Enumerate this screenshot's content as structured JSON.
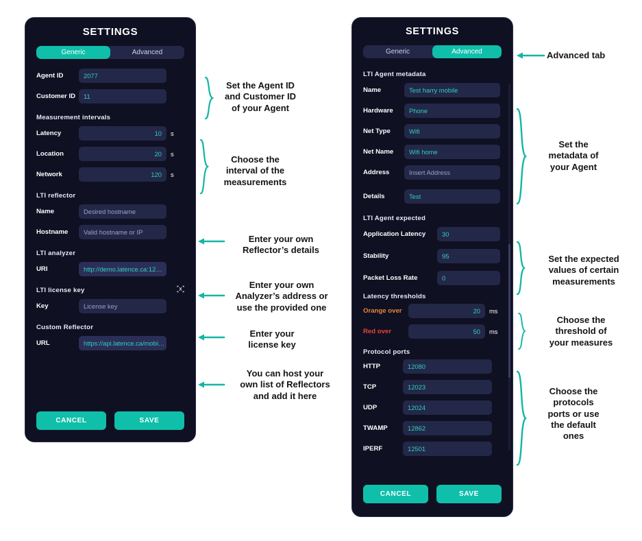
{
  "theme": {
    "page_bg": "#ffffff",
    "panel_bg": "#0f1022",
    "input_bg": "#232748",
    "accent_teal": "#0fbfaa",
    "value_teal": "#2fd0bb",
    "placeholder": "#9ca2c4",
    "orange": "#e8873a",
    "red": "#e8453c",
    "annotation_text": "#141414"
  },
  "generic_panel": {
    "title": "SETTINGS",
    "tabs": [
      {
        "label": "Generic",
        "active": true
      },
      {
        "label": "Advanced",
        "active": false
      }
    ],
    "identity": {
      "rows": [
        {
          "label": "Agent ID",
          "value": "2077",
          "placeholder": "",
          "align": "left"
        },
        {
          "label": "Customer ID",
          "value": "11",
          "placeholder": "",
          "align": "left"
        }
      ]
    },
    "measurement_intervals": {
      "heading": "Measurement intervals",
      "rows": [
        {
          "label": "Latency",
          "value": "10",
          "unit": "s",
          "align": "right"
        },
        {
          "label": "Location",
          "value": "20",
          "unit": "s",
          "align": "right"
        },
        {
          "label": "Network",
          "value": "120",
          "unit": "s",
          "align": "right"
        }
      ]
    },
    "lti_reflector": {
      "heading": "LTI reflector",
      "rows": [
        {
          "label": "Name",
          "value": "",
          "placeholder": "Desired hostname"
        },
        {
          "label": "Hostname",
          "value": "",
          "placeholder": "Valid hostname or IP"
        }
      ]
    },
    "lti_analyzer": {
      "heading": "LTI analyzer",
      "rows": [
        {
          "label": "URI",
          "value": "http://demo.latence.ca:12…",
          "placeholder": ""
        }
      ]
    },
    "lti_license_key": {
      "heading": "LTI license key",
      "icon": "scan-qr-icon",
      "rows": [
        {
          "label": "Key",
          "value": "",
          "placeholder": "License key"
        }
      ]
    },
    "custom_reflector": {
      "heading": "Custom Reflector",
      "rows": [
        {
          "label": "URL",
          "value": "https://api.latence.ca/mobi…",
          "placeholder": ""
        }
      ]
    },
    "buttons": {
      "cancel": "CANCEL",
      "save": "SAVE"
    }
  },
  "advanced_panel": {
    "title": "SETTINGS",
    "tabs": [
      {
        "label": "Generic",
        "active": false
      },
      {
        "label": "Advanced",
        "active": true
      }
    ],
    "agent_metadata": {
      "heading": "LTI Agent metadata",
      "rows": [
        {
          "label": "Name",
          "value": "Test harry mobile",
          "placeholder": ""
        },
        {
          "label": "Hardware",
          "value": "Phone",
          "placeholder": ""
        },
        {
          "label": "Net Type",
          "value": "Wifi",
          "placeholder": ""
        },
        {
          "label": "Net Name",
          "value": "Wifi home",
          "placeholder": ""
        },
        {
          "label": "Address",
          "value": "",
          "placeholder": "Insert Address"
        },
        {
          "label": "Details",
          "value": "Test",
          "placeholder": ""
        }
      ]
    },
    "agent_expected": {
      "heading": "LTI Agent expected",
      "rows": [
        {
          "label": "Application Latency",
          "value": "30"
        },
        {
          "label": "Stability",
          "value": "95"
        },
        {
          "label": "Packet Loss Rate",
          "value": "0"
        }
      ]
    },
    "latency_thresholds": {
      "heading": "Latency thresholds",
      "rows": [
        {
          "label": "Orange over",
          "value": "20",
          "unit": "ms",
          "color": "orange"
        },
        {
          "label": "Red over",
          "value": "50",
          "unit": "ms",
          "color": "red"
        }
      ]
    },
    "protocol_ports": {
      "heading": "Protocol ports",
      "rows": [
        {
          "label": "HTTP",
          "value": "12080"
        },
        {
          "label": "TCP",
          "value": "12023"
        },
        {
          "label": "UDP",
          "value": "12024"
        },
        {
          "label": "TWAMP",
          "value": "12862"
        },
        {
          "label": "IPERF",
          "value": "12501"
        }
      ]
    },
    "buttons": {
      "cancel": "CANCEL",
      "save": "SAVE"
    }
  },
  "annotations": {
    "left": [
      {
        "id": "agent-ids",
        "marker": "brace",
        "lines": [
          "Set the Agent ID",
          "and Customer ID",
          "of your Agent"
        ]
      },
      {
        "id": "intervals",
        "marker": "brace",
        "lines": [
          "Choose the",
          "interval of the",
          "measurements"
        ]
      },
      {
        "id": "reflector",
        "marker": "arrow",
        "lines": [
          "Enter your own",
          "Reflector’s details"
        ]
      },
      {
        "id": "analyzer",
        "marker": "arrow",
        "lines": [
          "Enter your own",
          "Analyzer’s address or",
          "use the provided one"
        ]
      },
      {
        "id": "license",
        "marker": "arrow",
        "lines": [
          "Enter your",
          "license key"
        ]
      },
      {
        "id": "custom-reflector",
        "marker": "arrow",
        "lines": [
          "You can host your",
          "own list of Reflectors",
          "and add it here"
        ]
      }
    ],
    "right": [
      {
        "id": "advanced-tab",
        "marker": "arrow",
        "lines": [
          "Advanced tab"
        ]
      },
      {
        "id": "metadata",
        "marker": "brace",
        "lines": [
          "Set the",
          "metadata of",
          "your Agent"
        ]
      },
      {
        "id": "expected",
        "marker": "brace",
        "lines": [
          "Set the expected",
          "values of certain",
          "measurements"
        ]
      },
      {
        "id": "thresholds",
        "marker": "brace",
        "lines": [
          "Choose the",
          "threshold of",
          "your measures"
        ]
      },
      {
        "id": "ports",
        "marker": "brace",
        "lines": [
          "Choose the",
          "protocols",
          "ports or use",
          "the default",
          "ones"
        ]
      }
    ]
  }
}
